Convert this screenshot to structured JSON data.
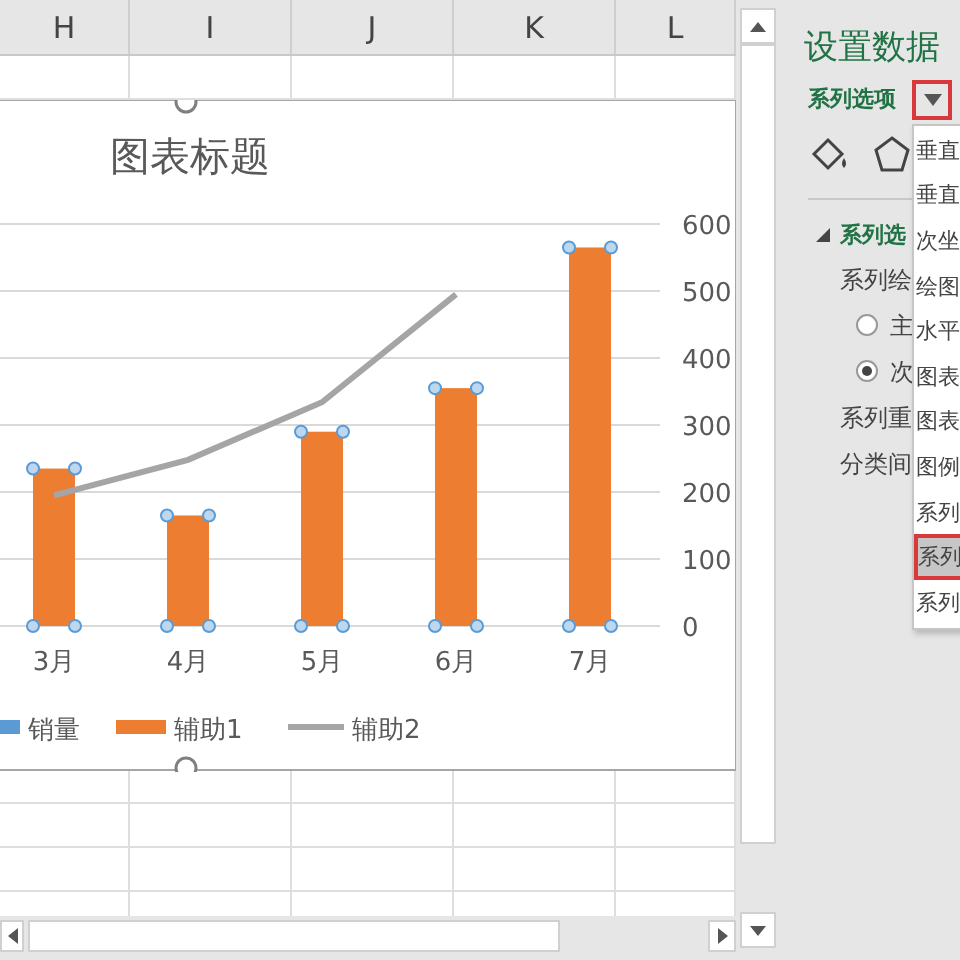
{
  "sheet": {
    "columns": [
      "H",
      "I",
      "J",
      "K",
      "L"
    ]
  },
  "chart": {
    "title": "图表标题",
    "chart_data": {
      "type": "bar",
      "grid": true,
      "legend": true,
      "categories": [
        "3月",
        "4月",
        "5月",
        "6月",
        "7月"
      ],
      "ylim": [
        0,
        600
      ],
      "yticks": [
        0,
        100,
        200,
        300,
        400,
        500,
        600
      ],
      "series": [
        {
          "name": "销量",
          "color": "#5b9bd5",
          "values": [
            null,
            null,
            null,
            null,
            null
          ]
        },
        {
          "name": "辅助1",
          "color": "#ed7d31",
          "values": [
            235,
            165,
            290,
            355,
            565
          ]
        },
        {
          "name": "辅助2",
          "type": "line",
          "color": "#a5a5a5",
          "values": [
            195,
            248,
            334,
            495,
            null
          ]
        }
      ]
    }
  },
  "panel": {
    "title": "设置数据",
    "series_options": "系列选项",
    "section": "系列选",
    "rows": [
      {
        "kind": "label",
        "text": "系列绘"
      },
      {
        "kind": "radio",
        "text": "主",
        "selected": false
      },
      {
        "kind": "radio",
        "text": "次",
        "selected": true
      },
      {
        "kind": "label",
        "text": "系列重"
      },
      {
        "kind": "label",
        "text": "分类间"
      }
    ],
    "dropdown": [
      {
        "label": "垂直",
        "selected": false
      },
      {
        "label": "垂直",
        "selected": false
      },
      {
        "label": "次坐",
        "selected": false
      },
      {
        "label": "绘图",
        "selected": false
      },
      {
        "label": "水平",
        "selected": false
      },
      {
        "label": "图表",
        "selected": false
      },
      {
        "label": "图表",
        "selected": false
      },
      {
        "label": "图例",
        "selected": false
      },
      {
        "label": "系列",
        "selected": false
      },
      {
        "label": "系列",
        "selected": true
      },
      {
        "label": "系列",
        "selected": false
      }
    ]
  }
}
